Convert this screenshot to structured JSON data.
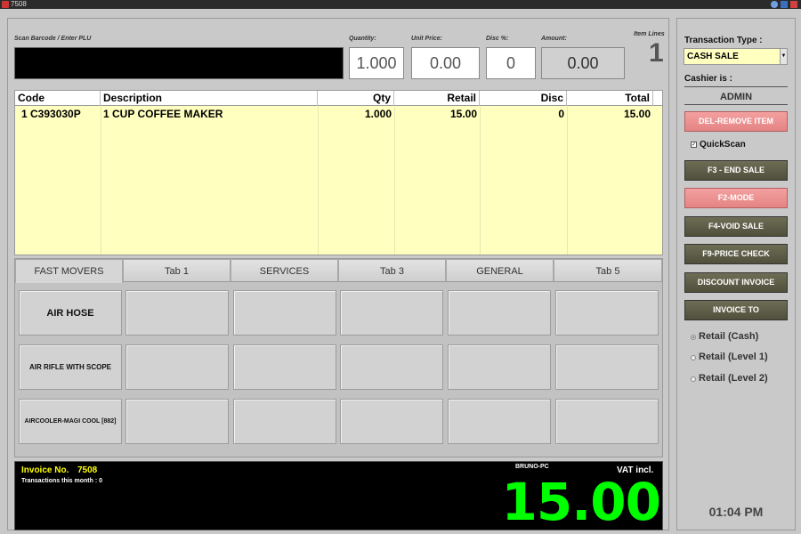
{
  "window": {
    "title": "7508"
  },
  "entry": {
    "scan_label": "Scan Barcode / Enter PLU",
    "scan_value": "",
    "quantity_label": "Quantity:",
    "quantity": "1.000",
    "unit_price_label": "Unit Price:",
    "unit_price": "0.00",
    "disc_label": "Disc %:",
    "disc": "0",
    "amount_label": "Amount:",
    "amount": "0.00",
    "item_lines_label": "Item Lines",
    "item_lines": "1"
  },
  "grid": {
    "columns": {
      "code": "Code",
      "description": "Description",
      "qty": "Qty",
      "retail": "Retail",
      "disc": "Disc",
      "total": "Total"
    },
    "rows": [
      {
        "code": "1 C393030P",
        "description": "1 CUP COFFEE MAKER",
        "qty": "1.000",
        "retail": "15.00",
        "disc": "0",
        "total": "15.00"
      }
    ]
  },
  "tabs": [
    "FAST MOVERS",
    "Tab 1",
    "SERVICES",
    "Tab 3",
    "GENERAL",
    "Tab 5"
  ],
  "tiles": [
    "AIR HOSE",
    "AIR RIFLE WITH SCOPE",
    "AIRCOOLER-MAGI COOL [882]"
  ],
  "totals": {
    "invoice_label": "Invoice No.",
    "invoice_no": "7508",
    "transactions_month": "Transactions this month : 0",
    "pc_name": "BRUNO-PC",
    "vat": "VAT incl.",
    "total": "15.00"
  },
  "sidebar": {
    "transaction_type_label": "Transaction Type :",
    "transaction_type": "CASH SALE",
    "cashier_label": "Cashier is :",
    "cashier": "ADMIN",
    "del_button": "DEL-REMOVE ITEM",
    "quickscan_label": "QuickScan",
    "end_sale": "F3 - END SALE",
    "mode": "F2-MODE",
    "void_sale": "F4-VOID SALE",
    "price_check": "F9-PRICE CHECK",
    "discount_invoice": "DISCOUNT INVOICE",
    "invoice_to": "INVOICE TO",
    "price_levels": [
      "Retail (Cash)",
      "Retail (Level 1)",
      "Retail (Level 2)"
    ],
    "clock": "01:04 PM"
  },
  "colors": {
    "grid_bg": "#ffffc0",
    "total_green": "#00ff00",
    "pink_button": "#e58484",
    "olive_button": "#5e5e48"
  }
}
